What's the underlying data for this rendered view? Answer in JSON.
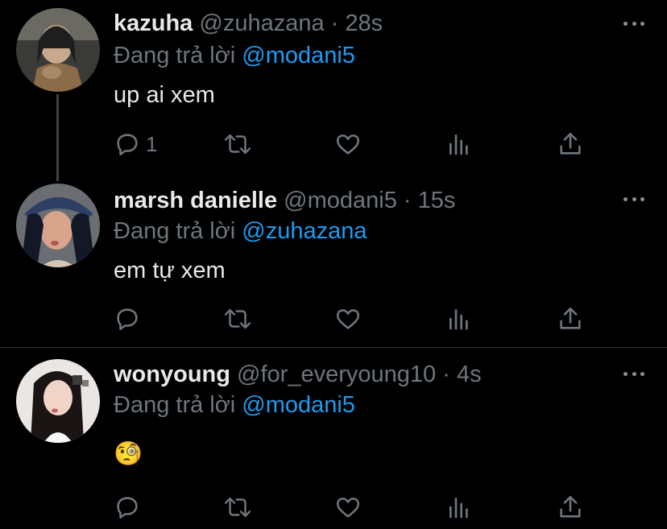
{
  "tweets": [
    {
      "name": "kazuha",
      "handle": "@zuhazana",
      "time": "28s",
      "reply_prefix": "Đang trả lời ",
      "reply_to": "@modani5",
      "text": "up ai xem",
      "reply_count": "1",
      "avatar_colors": [
        "#3a3a36",
        "#c9a98e",
        "#1e1e1e"
      ]
    },
    {
      "name": "marsh danielle",
      "handle": "@modani5",
      "time": "15s",
      "reply_prefix": "Đang trả lời ",
      "reply_to": "@zuhazana",
      "text": "em tự xem",
      "reply_count": "",
      "avatar_colors": [
        "#2e3f63",
        "#d9a48c",
        "#121826"
      ]
    },
    {
      "name": "wonyoung",
      "handle": "@for_everyoung10",
      "time": "4s",
      "reply_prefix": "Đang trả lời ",
      "reply_to": "@modani5",
      "text": "🧐",
      "reply_count": "",
      "avatar_colors": [
        "#e9e6e4",
        "#f0d4c8",
        "#1a1414"
      ]
    }
  ],
  "dot_separator": "·",
  "icons": {
    "reply": "reply-icon",
    "retweet": "retweet-icon",
    "like": "heart-icon",
    "analytics": "analytics-icon",
    "share": "share-icon",
    "more": "more-icon"
  },
  "colors": {
    "background": "#000000",
    "text": "#e7e9ea",
    "muted": "#6e767d",
    "accent": "#1d9bf0",
    "divider": "#2f3336"
  }
}
